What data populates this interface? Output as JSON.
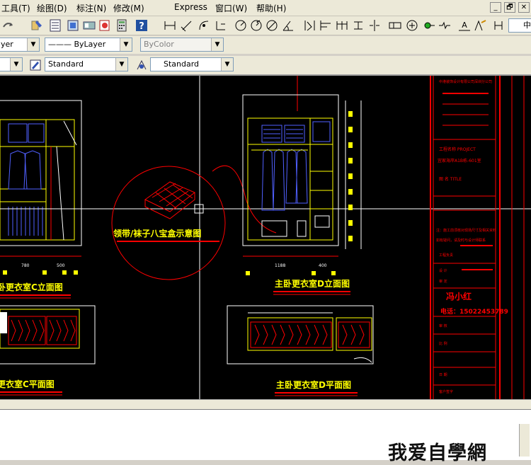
{
  "menu": [
    "工具(T)",
    "绘图(D)",
    "标注(N)",
    "修改(M)",
    "Express",
    "窗口(W)",
    "帮助(H)"
  ],
  "window_buttons": [
    "_",
    "🗗",
    "✕"
  ],
  "toolbar": {
    "layer_combo": "yer",
    "linetype_combo": "——— ByLayer",
    "lineweight_combo": "ByColor",
    "textstyle_combo": "Standard",
    "dimstyle_combo": "Standard",
    "right_label": "中"
  },
  "drawing": {
    "label_tie_box": "领带/袜子八宝盒示意图",
    "label_c_elev": "卧更衣室C立面图",
    "label_d_elev": "主卧更衣室D立面图",
    "label_c_plan": "更衣室C平面图",
    "label_d_plan": "主卧更衣室D平面图",
    "dim_780": "780",
    "dim_500": "500",
    "dim_1188": "1188",
    "dim_400": "400",
    "title_block": {
      "t1": "中港装饰设计有限公司深圳分公司",
      "t2": "工程名称 PROJECT",
      "t3": "宜家海岸A1B栋-601室",
      "t4": "图 名 TITLE",
      "t5": "注：施工前须核对现场尺寸及相关资料",
      "t6": "如有疑问，请及时与设计师联系",
      "t7": "工程负责",
      "t8": "设 计",
      "t9": "审 定",
      "designer": "冯小红",
      "phone": "电话：15022453789",
      "t10": "审 核",
      "t11": "比 例",
      "t12": "日 期",
      "t13": "客户签字"
    }
  },
  "watermark": "我爱自學網",
  "colors": {
    "yellow": "#ffff00",
    "red": "#ff0000",
    "white": "#ffffff",
    "blue": "#5060ff",
    "canvas": "#000000"
  }
}
